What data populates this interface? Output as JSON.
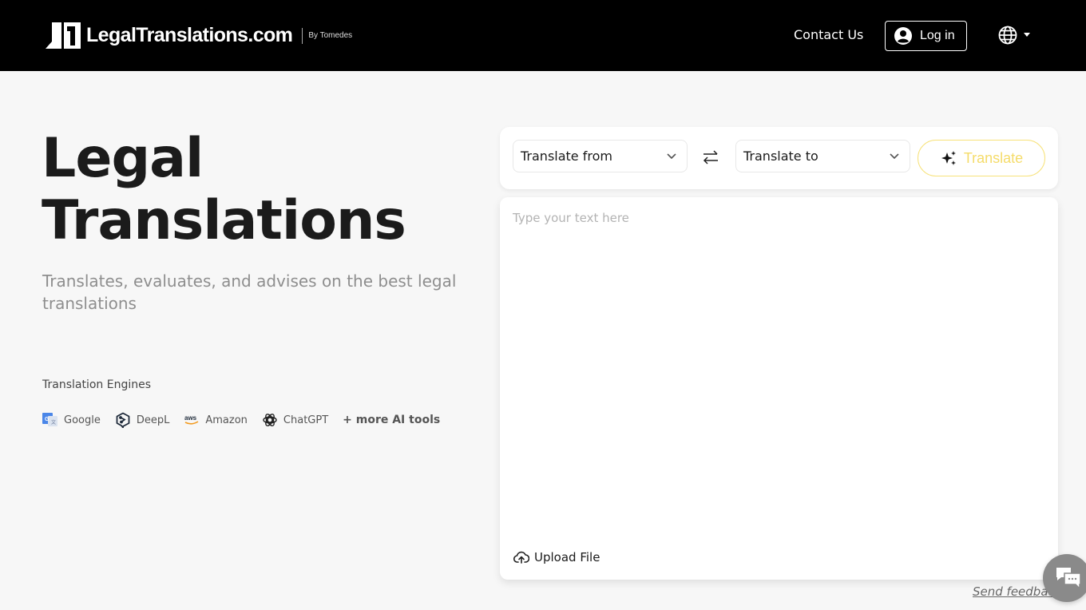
{
  "header": {
    "logo_text": "LegalTranslations.com",
    "logo_by": "By Tomedes",
    "contact_label": "Contact Us",
    "login_label": "Log in",
    "language_icon": "globe-icon"
  },
  "hero": {
    "title_line1": "Legal",
    "title_line2": "Translations",
    "subtitle": "Translates, evaluates, and advises on the best legal translations",
    "engines_label": "Translation Engines",
    "engines": [
      {
        "name": "Google",
        "icon": "google-translate-icon"
      },
      {
        "name": "DeepL",
        "icon": "deepl-icon"
      },
      {
        "name": "Amazon",
        "icon": "aws-icon"
      },
      {
        "name": "ChatGPT",
        "icon": "chatgpt-icon"
      }
    ],
    "more_label": "+ more AI tools"
  },
  "translator": {
    "from_placeholder": "Translate from",
    "to_placeholder": "Translate to",
    "swap_icon": "swap-arrows-icon",
    "translate_label": "Translate",
    "text_placeholder": "Type your text here",
    "text_value": "",
    "upload_label": "Upload File",
    "accent_color": "#f5dc6a"
  },
  "footer": {
    "feedback_label": "Send feedback",
    "chat_icon": "chat-bubbles-icon"
  }
}
